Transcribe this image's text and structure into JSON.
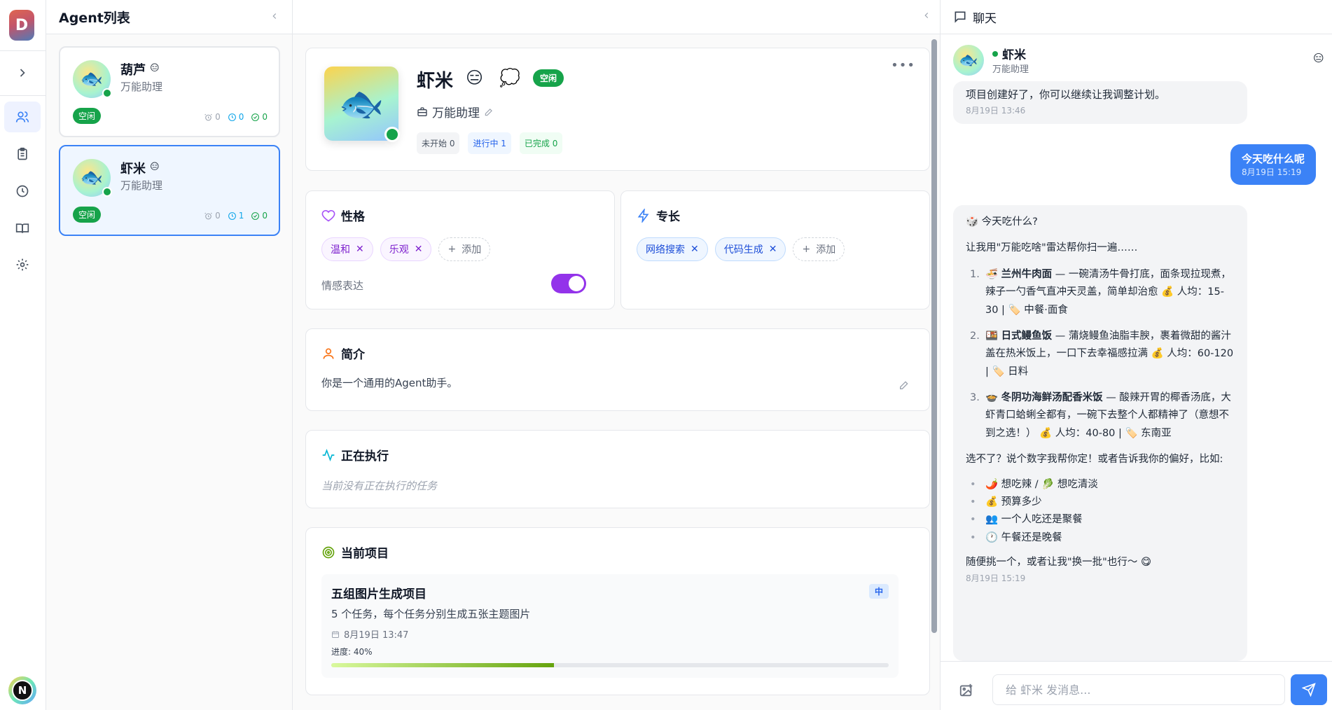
{
  "app": {
    "logo_letter": "D",
    "user_initial": "N"
  },
  "agents_panel": {
    "title": "Agent列表",
    "agents": [
      {
        "name": "葫芦",
        "mood_emoji": "😑",
        "role": "万能助理",
        "status": "空闲",
        "stats": {
          "alarms": "0",
          "clock": "0",
          "done": "0"
        }
      },
      {
        "name": "虾米",
        "mood_emoji": "😑",
        "role": "万能助理",
        "status": "空闲",
        "stats": {
          "alarms": "0",
          "clock": "1",
          "done": "0"
        }
      }
    ]
  },
  "profile": {
    "name": "虾米",
    "face_emoji": "😑",
    "thought_emoji": "💭",
    "status": "空闲",
    "role": "万能助理",
    "fish_emoji": "🐟",
    "pills": {
      "not_started": "未开始 0",
      "in_progress": "进行中 1",
      "completed": "已完成 0"
    }
  },
  "personality": {
    "title": "性格",
    "tags": [
      "温和",
      "乐观"
    ],
    "add_label": "添加",
    "emotion_label": "情感表达",
    "emotion_enabled": true
  },
  "skills": {
    "title": "专长",
    "tags": [
      "网络搜索",
      "代码生成"
    ],
    "add_label": "添加"
  },
  "intro": {
    "title": "简介",
    "text": "你是一个通用的Agent助手。"
  },
  "executing": {
    "title": "正在执行",
    "empty_text": "当前没有正在执行的任务"
  },
  "project": {
    "title": "当前项目",
    "name": "五组图片生成项目",
    "priority": "中",
    "description": "5 个任务，每个任务分别生成五张主题图片",
    "date": "8月19日 13:47",
    "progress_label": "进度: 40%",
    "progress": 0.4
  },
  "chat": {
    "title": "聊天",
    "agent_name": "虾米",
    "agent_role": "万能助理",
    "mood_emoji": "😑",
    "messages": {
      "m1": {
        "text": "项目创建好了，你可以继续让我调整计划。",
        "time": "8月19日 13:46"
      },
      "m2": {
        "text": "今天吃什么呢",
        "time": "8月19日 15:19"
      },
      "m3": {
        "heading": "🎲 今天吃什么?",
        "intro": "让我用\"万能吃啥\"雷达帮你扫一遍……",
        "recs": [
          {
            "num": "1.",
            "emoji": "🍜",
            "name": "兰州牛肉面",
            "desc": " — 一碗清汤牛骨打底，面条现拉现煮，辣子一勺香气直冲天灵盖，简单却治愈 💰 人均：15-30 | 🏷️ 中餐·面食"
          },
          {
            "num": "2.",
            "emoji": "🍱",
            "name": "日式鳗鱼饭",
            "desc": " — 蒲烧鳗鱼油脂丰腴，裹着微甜的酱汁盖在热米饭上，一口下去幸福感拉满 💰 人均：60-120 | 🏷️ 日料"
          },
          {
            "num": "3.",
            "emoji": "🍲",
            "name": "冬阴功海鲜汤配香米饭",
            "desc": " — 酸辣开胃的椰香汤底，大虾青口蛤蜊全都有，一碗下去整个人都精神了（意想不到之选！） 💰 人均：40-80 | 🏷️ 东南亚"
          }
        ],
        "choose_text": "选不了？说个数字我帮你定！或者告诉我你的偏好，比如:",
        "prefs": [
          "🌶️ 想吃辣 / 🥬 想吃清淡",
          "💰 预算多少",
          "👥 一个人吃还是聚餐",
          "🕐 午餐还是晚餐"
        ],
        "outro": "随便挑一个，或者让我\"换一批\"也行～ 😋",
        "time": "8月19日 15:19"
      }
    },
    "input_placeholder": "给 虾米 发消息..."
  }
}
